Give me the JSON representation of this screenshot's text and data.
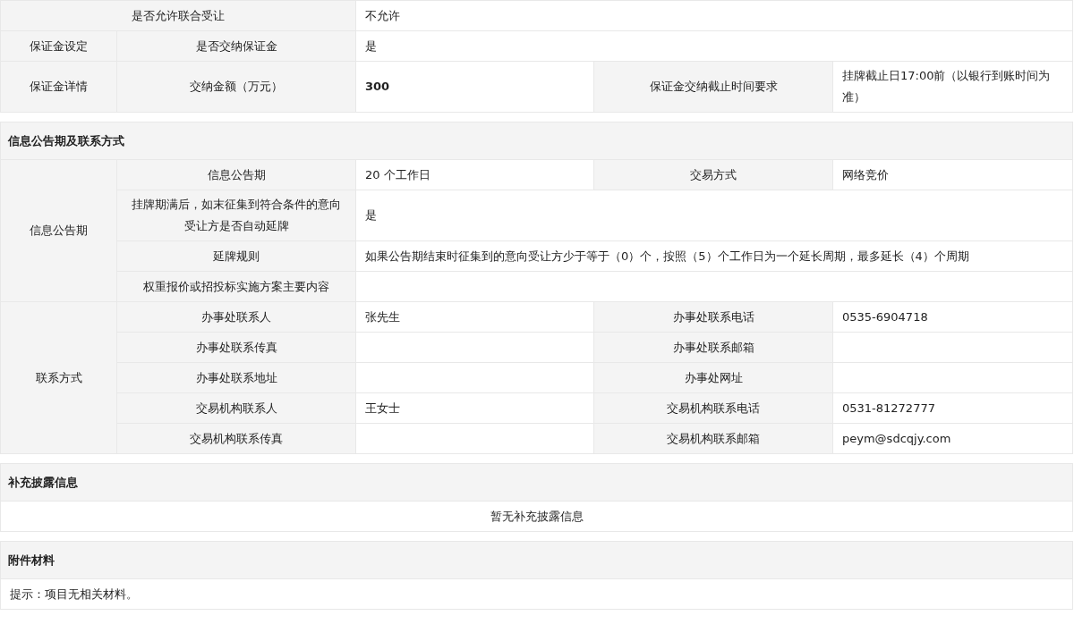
{
  "sections": [
    {
      "rows": [
        [
          {
            "kind": "label",
            "text": "是否允许联合受让",
            "colspan": 2
          },
          {
            "kind": "value",
            "text": "不允许",
            "colspan": 3
          }
        ],
        [
          {
            "kind": "label",
            "text": "保证金设定"
          },
          {
            "kind": "label",
            "text": "是否交纳保证金"
          },
          {
            "kind": "value",
            "text": "是",
            "colspan": 3
          }
        ],
        [
          {
            "kind": "label",
            "text": "保证金详情"
          },
          {
            "kind": "label",
            "text": "交纳金额（万元）"
          },
          {
            "kind": "value",
            "text": "300",
            "bold": true
          },
          {
            "kind": "label",
            "text": "保证金交纳截止时间要求"
          },
          {
            "kind": "value",
            "text": "挂牌截止日17:00前（以银行到账时间为准）"
          }
        ]
      ]
    },
    {
      "heading": "信息公告期及联系方式",
      "rows": [
        [
          {
            "kind": "label",
            "text": "信息公告期",
            "rowspan": 4
          },
          {
            "kind": "label",
            "text": "信息公告期"
          },
          {
            "kind": "value",
            "text": "20 个工作日"
          },
          {
            "kind": "label",
            "text": "交易方式"
          },
          {
            "kind": "value",
            "text": "网络竞价"
          }
        ],
        [
          {
            "kind": "label",
            "text": "挂牌期满后，如末征集到符合条件的意向受让方是否自动延牌"
          },
          {
            "kind": "value",
            "text": "是",
            "colspan": 3
          }
        ],
        [
          {
            "kind": "label",
            "text": "延牌规则"
          },
          {
            "kind": "value",
            "text": "如果公告期结束时征集到的意向受让方少于等于（0）个，按照（5）个工作日为一个延长周期，最多延长（4）个周期",
            "colspan": 3
          }
        ],
        [
          {
            "kind": "label",
            "text": "权重报价或招投标实施方案主要内容"
          },
          {
            "kind": "value",
            "colspan": 3
          }
        ],
        [
          {
            "kind": "label",
            "text": "联系方式",
            "rowspan": 5
          },
          {
            "kind": "label",
            "text": "办事处联系人"
          },
          {
            "kind": "value",
            "text": "张先生"
          },
          {
            "kind": "label",
            "text": "办事处联系电话"
          },
          {
            "kind": "value",
            "text": "0535-6904718"
          }
        ],
        [
          {
            "kind": "label",
            "text": "办事处联系传真"
          },
          {
            "kind": "value"
          },
          {
            "kind": "label",
            "text": "办事处联系邮箱"
          },
          {
            "kind": "value"
          }
        ],
        [
          {
            "kind": "label",
            "text": "办事处联系地址"
          },
          {
            "kind": "value"
          },
          {
            "kind": "label",
            "text": "办事处网址"
          },
          {
            "kind": "value"
          }
        ],
        [
          {
            "kind": "label",
            "text": "交易机构联系人"
          },
          {
            "kind": "value",
            "text": "王女士"
          },
          {
            "kind": "label",
            "text": "交易机构联系电话"
          },
          {
            "kind": "value",
            "text": "0531-81272777"
          }
        ],
        [
          {
            "kind": "label",
            "text": "交易机构联系传真"
          },
          {
            "kind": "value"
          },
          {
            "kind": "label",
            "text": "交易机构联系邮箱"
          },
          {
            "kind": "value",
            "text": "peym@sdcqjy.com"
          }
        ]
      ]
    },
    {
      "heading": "补充披露信息",
      "rows": [
        [
          {
            "kind": "note",
            "text": "暂无补充披露信息",
            "colspan": 5
          }
        ]
      ]
    },
    {
      "heading": "附件材料",
      "rows": [
        [
          {
            "kind": "value",
            "text": "提示：项目无相关材料。",
            "colspan": 5
          }
        ]
      ]
    }
  ]
}
